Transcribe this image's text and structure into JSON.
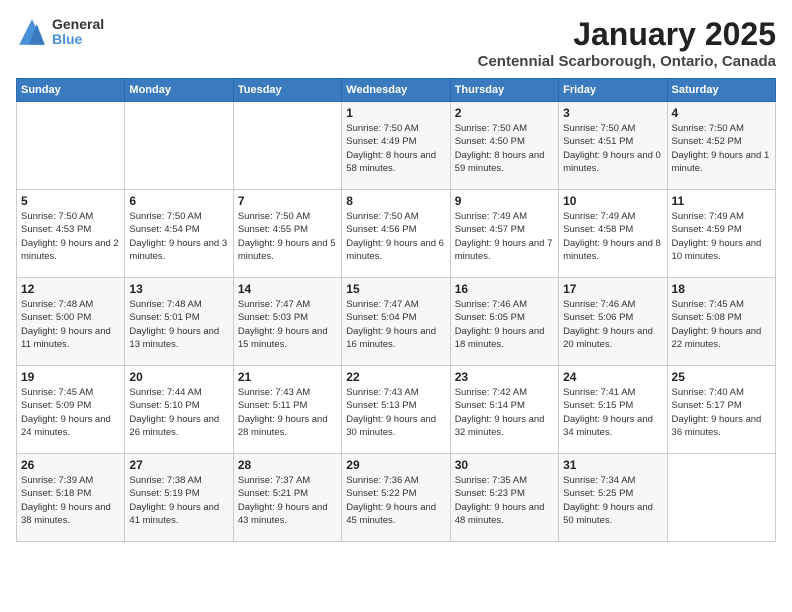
{
  "logo": {
    "general": "General",
    "blue": "Blue"
  },
  "title": "January 2025",
  "location": "Centennial Scarborough, Ontario, Canada",
  "days_of_week": [
    "Sunday",
    "Monday",
    "Tuesday",
    "Wednesday",
    "Thursday",
    "Friday",
    "Saturday"
  ],
  "weeks": [
    [
      {
        "day": "",
        "info": ""
      },
      {
        "day": "",
        "info": ""
      },
      {
        "day": "",
        "info": ""
      },
      {
        "day": "1",
        "info": "Sunrise: 7:50 AM\nSunset: 4:49 PM\nDaylight: 8 hours and 58 minutes."
      },
      {
        "day": "2",
        "info": "Sunrise: 7:50 AM\nSunset: 4:50 PM\nDaylight: 8 hours and 59 minutes."
      },
      {
        "day": "3",
        "info": "Sunrise: 7:50 AM\nSunset: 4:51 PM\nDaylight: 9 hours and 0 minutes."
      },
      {
        "day": "4",
        "info": "Sunrise: 7:50 AM\nSunset: 4:52 PM\nDaylight: 9 hours and 1 minute."
      }
    ],
    [
      {
        "day": "5",
        "info": "Sunrise: 7:50 AM\nSunset: 4:53 PM\nDaylight: 9 hours and 2 minutes."
      },
      {
        "day": "6",
        "info": "Sunrise: 7:50 AM\nSunset: 4:54 PM\nDaylight: 9 hours and 3 minutes."
      },
      {
        "day": "7",
        "info": "Sunrise: 7:50 AM\nSunset: 4:55 PM\nDaylight: 9 hours and 5 minutes."
      },
      {
        "day": "8",
        "info": "Sunrise: 7:50 AM\nSunset: 4:56 PM\nDaylight: 9 hours and 6 minutes."
      },
      {
        "day": "9",
        "info": "Sunrise: 7:49 AM\nSunset: 4:57 PM\nDaylight: 9 hours and 7 minutes."
      },
      {
        "day": "10",
        "info": "Sunrise: 7:49 AM\nSunset: 4:58 PM\nDaylight: 9 hours and 8 minutes."
      },
      {
        "day": "11",
        "info": "Sunrise: 7:49 AM\nSunset: 4:59 PM\nDaylight: 9 hours and 10 minutes."
      }
    ],
    [
      {
        "day": "12",
        "info": "Sunrise: 7:48 AM\nSunset: 5:00 PM\nDaylight: 9 hours and 11 minutes."
      },
      {
        "day": "13",
        "info": "Sunrise: 7:48 AM\nSunset: 5:01 PM\nDaylight: 9 hours and 13 minutes."
      },
      {
        "day": "14",
        "info": "Sunrise: 7:47 AM\nSunset: 5:03 PM\nDaylight: 9 hours and 15 minutes."
      },
      {
        "day": "15",
        "info": "Sunrise: 7:47 AM\nSunset: 5:04 PM\nDaylight: 9 hours and 16 minutes."
      },
      {
        "day": "16",
        "info": "Sunrise: 7:46 AM\nSunset: 5:05 PM\nDaylight: 9 hours and 18 minutes."
      },
      {
        "day": "17",
        "info": "Sunrise: 7:46 AM\nSunset: 5:06 PM\nDaylight: 9 hours and 20 minutes."
      },
      {
        "day": "18",
        "info": "Sunrise: 7:45 AM\nSunset: 5:08 PM\nDaylight: 9 hours and 22 minutes."
      }
    ],
    [
      {
        "day": "19",
        "info": "Sunrise: 7:45 AM\nSunset: 5:09 PM\nDaylight: 9 hours and 24 minutes."
      },
      {
        "day": "20",
        "info": "Sunrise: 7:44 AM\nSunset: 5:10 PM\nDaylight: 9 hours and 26 minutes."
      },
      {
        "day": "21",
        "info": "Sunrise: 7:43 AM\nSunset: 5:11 PM\nDaylight: 9 hours and 28 minutes."
      },
      {
        "day": "22",
        "info": "Sunrise: 7:43 AM\nSunset: 5:13 PM\nDaylight: 9 hours and 30 minutes."
      },
      {
        "day": "23",
        "info": "Sunrise: 7:42 AM\nSunset: 5:14 PM\nDaylight: 9 hours and 32 minutes."
      },
      {
        "day": "24",
        "info": "Sunrise: 7:41 AM\nSunset: 5:15 PM\nDaylight: 9 hours and 34 minutes."
      },
      {
        "day": "25",
        "info": "Sunrise: 7:40 AM\nSunset: 5:17 PM\nDaylight: 9 hours and 36 minutes."
      }
    ],
    [
      {
        "day": "26",
        "info": "Sunrise: 7:39 AM\nSunset: 5:18 PM\nDaylight: 9 hours and 38 minutes."
      },
      {
        "day": "27",
        "info": "Sunrise: 7:38 AM\nSunset: 5:19 PM\nDaylight: 9 hours and 41 minutes."
      },
      {
        "day": "28",
        "info": "Sunrise: 7:37 AM\nSunset: 5:21 PM\nDaylight: 9 hours and 43 minutes."
      },
      {
        "day": "29",
        "info": "Sunrise: 7:36 AM\nSunset: 5:22 PM\nDaylight: 9 hours and 45 minutes."
      },
      {
        "day": "30",
        "info": "Sunrise: 7:35 AM\nSunset: 5:23 PM\nDaylight: 9 hours and 48 minutes."
      },
      {
        "day": "31",
        "info": "Sunrise: 7:34 AM\nSunset: 5:25 PM\nDaylight: 9 hours and 50 minutes."
      },
      {
        "day": "",
        "info": ""
      }
    ]
  ]
}
